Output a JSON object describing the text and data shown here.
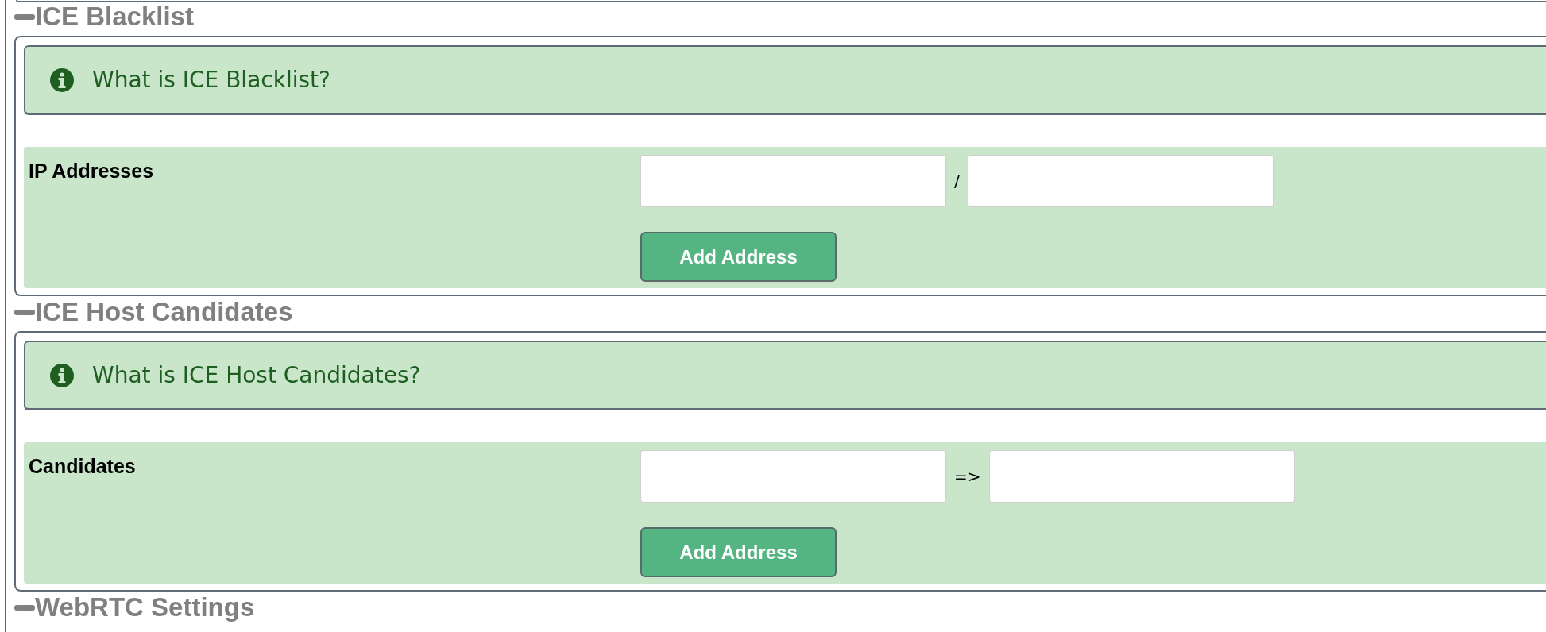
{
  "sections": [
    {
      "title": "ICE Blacklist",
      "expanded": true,
      "info": "What is ICE Blacklist?",
      "field_label": "IP Addresses",
      "separator": "/",
      "button": "Add Address"
    },
    {
      "title": "ICE Host Candidates",
      "expanded": true,
      "info": "What is ICE Host Candidates?",
      "field_label": "Candidates",
      "separator": "=>",
      "button": "Add Address"
    },
    {
      "title": "WebRTC Settings",
      "expanded": true
    }
  ]
}
